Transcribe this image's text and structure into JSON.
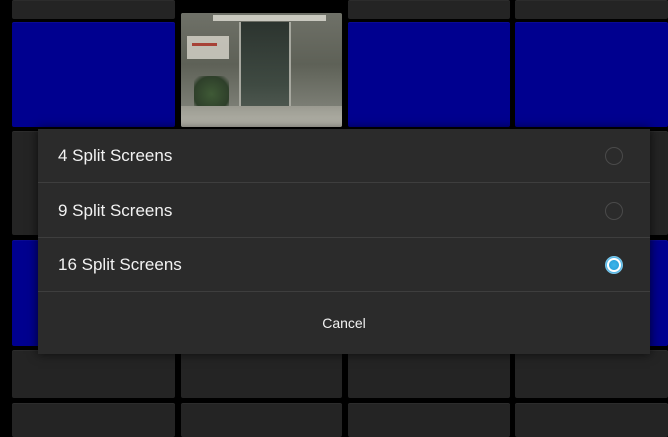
{
  "dialog": {
    "options": [
      {
        "label": "4 Split Screens",
        "selected": false
      },
      {
        "label": "9 Split Screens",
        "selected": false
      },
      {
        "label": "16 Split Screens",
        "selected": true
      }
    ],
    "cancel_label": "Cancel"
  },
  "colors": {
    "tile_blue": "#00008f",
    "tile_dark": "#242424",
    "dialog_bg": "#2b2b2b",
    "radio_accent": "#3fb5ea"
  },
  "grid": {
    "columns": 4,
    "rows": 4
  }
}
